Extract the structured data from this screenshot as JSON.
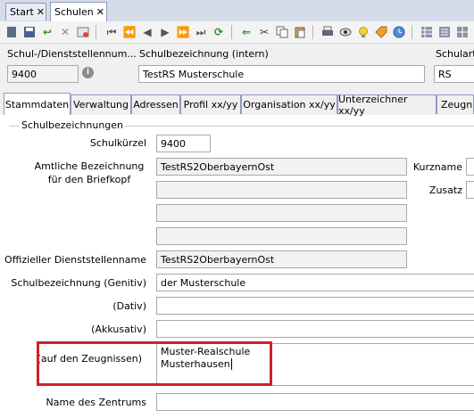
{
  "doc_tabs": [
    {
      "label": "Start"
    },
    {
      "label": "Schulen"
    }
  ],
  "header": {
    "number_label": "Schul-/Dienststellennum...",
    "number_value": "9400",
    "name_label": "Schulbezeichnung (intern)",
    "name_value": "TestRS Musterschule",
    "type_label": "Schulart",
    "type_value": "RS"
  },
  "sub_tabs": [
    {
      "label": "Stammdaten"
    },
    {
      "label": "Verwaltung"
    },
    {
      "label": "Adressen"
    },
    {
      "label": "Profil xx/yy"
    },
    {
      "label": "Organisation xx/yy"
    },
    {
      "label": "Unterzeichner xx/yy"
    },
    {
      "label": "Zeugni"
    }
  ],
  "group": {
    "title": "Schulbezeichnungen"
  },
  "form": {
    "kuerzel_label": "Schulkürzel",
    "kuerzel_value": "9400",
    "amtlich_label_1": "Amtliche Bezeichnung",
    "amtlich_label_2": "für den Briefkopf",
    "amtlich_lines": [
      "TestRS2OberbayernOst",
      "",
      "",
      ""
    ],
    "kurzname_label": "Kurzname",
    "zusatz_label": "Zusatz",
    "dienststelle_label": "Offizieller Dienststellenname",
    "dienststelle_value": "TestRS2OberbayernOst",
    "genitiv_label": "Schulbezeichnung (Genitiv)",
    "genitiv_value": "der Musterschule",
    "dativ_label": "(Dativ)",
    "dativ_value": "",
    "akkusativ_label": "(Akkusativ)",
    "akkusativ_value": "",
    "zeugnis_label": "(auf den Zeugnissen)",
    "zeugnis_line1": "Muster-Realschule",
    "zeugnis_line2": "Musterhausen",
    "zentrum_label": "Name des Zentrums",
    "zentrum_value": ""
  },
  "highlight_color": "#d0202a"
}
